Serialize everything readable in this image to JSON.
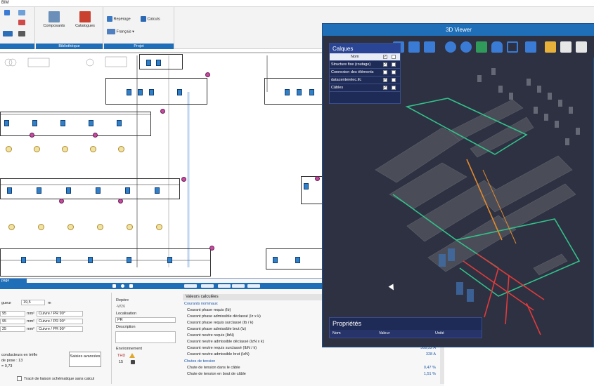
{
  "menu": {
    "tab_bim": "BIM"
  },
  "ribbon": {
    "groups": [
      {
        "title": "Bibliothèque",
        "buttons": [
          "Composants",
          "Catalogues"
        ]
      },
      {
        "title": "Projet",
        "buttons": [
          "Repérage",
          "Calculs",
          "Français"
        ]
      }
    ]
  },
  "dialog": {
    "tab": "page",
    "length_label": "gueur",
    "length_value": "19,5",
    "length_unit": "m",
    "sections": [
      {
        "value": "95",
        "unit": "mm²",
        "material": "Cuivre / PR 90°"
      },
      {
        "value": "95",
        "unit": "mm²",
        "material": "Cuivre / PR 90°"
      },
      {
        "value": "25",
        "unit": "mm²",
        "material": "Cuivre / PR 90°"
      }
    ],
    "trefle": "conducteurs en trèfle",
    "pose": "de pose : 13",
    "coef": "= 0,73",
    "advanced_button": "Saisies avancées",
    "trace_checkbox": "Tracé de liaison schématique sans calcul",
    "repere_label": "Repère",
    "repere_value": "-W26",
    "localisation_label": "Localisation",
    "localisation_value": "PR",
    "description_label": "Description",
    "environnement_label": "Environnement",
    "thd": "THD",
    "thd_value": "15",
    "valeurs_title": "Valeurs calculées",
    "courants_title": "Courants nominaux",
    "chutes_title": "Chutes de tension",
    "rows": [
      {
        "label": "Courant phase requis (Ib)",
        "value": ""
      },
      {
        "label": "Courant phase admissible déclassé (Iz x k)",
        "value": ""
      },
      {
        "label": "Courant phase requis surclassé (Ib / k)",
        "value": ""
      },
      {
        "label": "Courant phase admissible brut (Iz)",
        "value": ""
      },
      {
        "label": "Courant neutre requis (IbN)",
        "value": ""
      },
      {
        "label": "Courant neutre admissible déclassé (IzN x k)",
        "value": ""
      },
      {
        "label": "Courant neutre requis surclassé (IbN / k)",
        "value": "308,22 A"
      },
      {
        "label": "Courant neutre admissible brut (IzN)",
        "value": "328 A"
      }
    ],
    "chute_rows": [
      {
        "label": "Chute de tension dans le câble",
        "value": "0,47 %"
      },
      {
        "label": "Chute de tension en bout de câble",
        "value": "1,51 %"
      }
    ]
  },
  "viewer": {
    "title": "3D Viewer",
    "layers_title": "Calques",
    "layers_header": "Nom",
    "layers": [
      {
        "name": "Structure fixe (routage)",
        "checked": "✓"
      },
      {
        "name": "Connexion des éléments",
        "checked": ""
      },
      {
        "name": "datacenterelec.ifc",
        "checked": "✓"
      },
      {
        "name": "Câbles",
        "checked": "✓"
      }
    ],
    "props_title": "Propriétés",
    "props_cols": [
      "Nom",
      "Valeur",
      "Unité"
    ]
  },
  "colors": {
    "accent": "#1f6fb8",
    "viewer_bg": "#2d3142",
    "cable_green": "#33c28a",
    "cable_red": "#e23a3a",
    "cable_orange": "#e38a2c"
  }
}
